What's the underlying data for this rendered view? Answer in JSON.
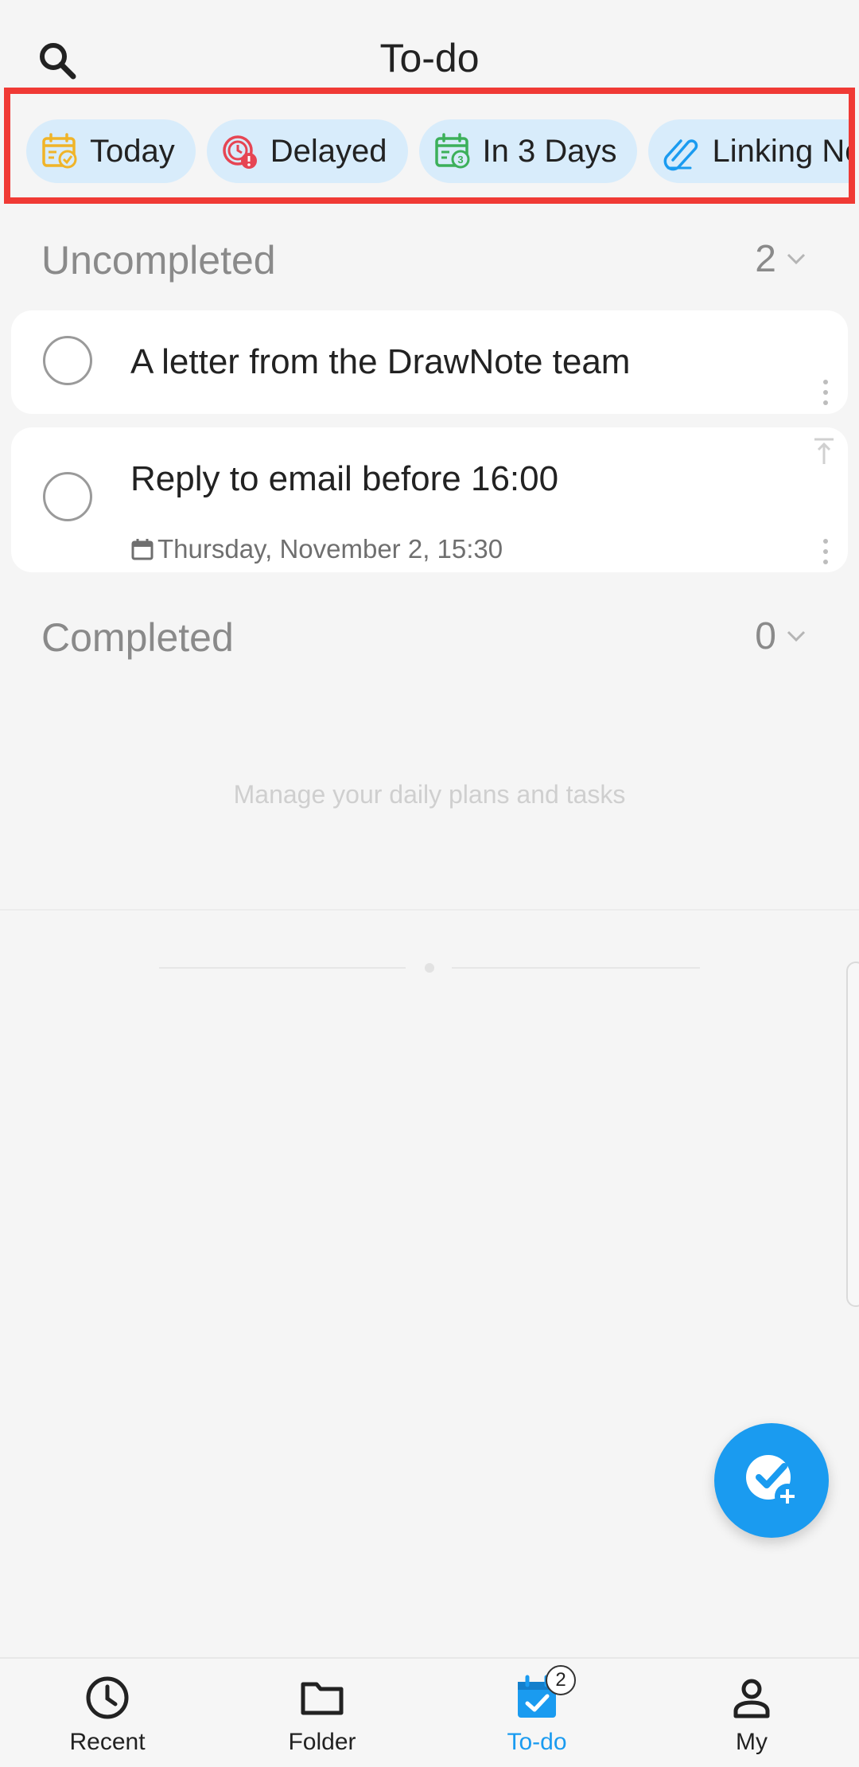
{
  "header": {
    "title": "To-do",
    "search_icon": "search-icon"
  },
  "filters": [
    {
      "label": "Today",
      "icon": "calendar-check-icon",
      "color": "#f0b429"
    },
    {
      "label": "Delayed",
      "icon": "overdue-clock-icon",
      "color": "#e64553"
    },
    {
      "label": "In 3 Days",
      "icon": "calendar-3-icon",
      "color": "#3cb05a"
    },
    {
      "label": "Linking Note",
      "icon": "paperclip-icon",
      "color": "#1a9bf0"
    }
  ],
  "sections": {
    "uncompleted": {
      "label": "Uncompleted",
      "count": "2"
    },
    "completed": {
      "label": "Completed",
      "count": "0"
    }
  },
  "tasks": [
    {
      "title": "A letter from the DrawNote team"
    },
    {
      "title": "Reply to email before 16:00",
      "date": "Thursday, November 2, 15:30"
    }
  ],
  "empty_hint": "Manage your daily plans and tasks",
  "nav": {
    "items": [
      {
        "label": "Recent",
        "icon": "clock-icon"
      },
      {
        "label": "Folder",
        "icon": "folder-icon"
      },
      {
        "label": "To-do",
        "icon": "todo-calendar-icon"
      },
      {
        "label": "My",
        "icon": "person-icon"
      }
    ],
    "todo_badge": "2"
  },
  "colors": {
    "accent": "#1a9bf0",
    "highlight_border": "#f03a35",
    "chip_bg": "#d8ecfb"
  }
}
